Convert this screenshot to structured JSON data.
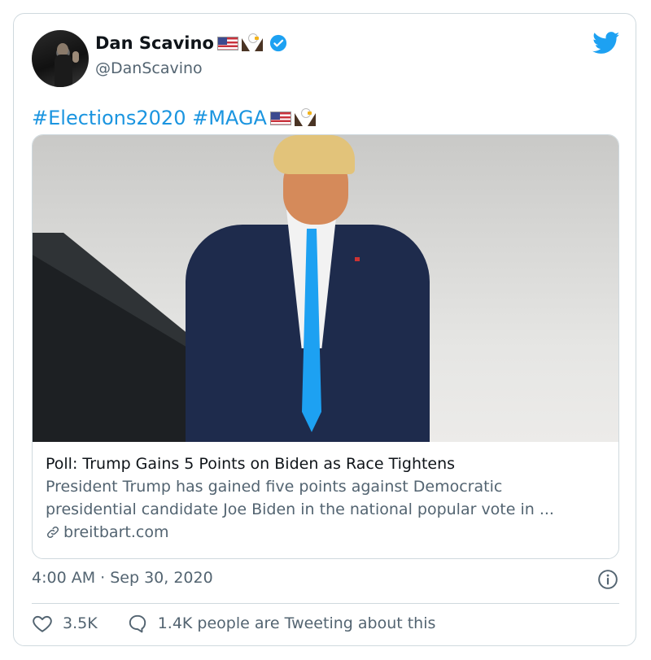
{
  "author": {
    "display_name": "Dan Scavino",
    "handle": "@DanScavino",
    "name_emoji": [
      "us-flag-emoji",
      "eagle-emoji"
    ],
    "verified": true
  },
  "tweet": {
    "hashtags": [
      "#Elections2020",
      "#MAGA"
    ],
    "text_emoji": [
      "us-flag-emoji",
      "eagle-emoji"
    ]
  },
  "link_card": {
    "title": "Poll: Trump Gains 5 Points on Biden as Race Tightens",
    "description_line1": "President Trump has gained five points against Democratic",
    "description_line2": "presidential candidate Joe Biden in the national popular vote in ...",
    "domain": "breitbart.com"
  },
  "timestamp": "4:00 AM · Sep 30, 2020",
  "stats": {
    "likes": "3.5K",
    "replies_text": "1.4K people are Tweeting about this"
  },
  "colors": {
    "accent": "#1b95e0",
    "twitter_blue": "#1da1f2",
    "secondary_text": "#536471",
    "border": "#cfd9de"
  }
}
